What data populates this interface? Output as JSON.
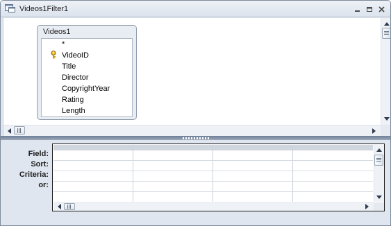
{
  "window": {
    "title": "Videos1Filter1",
    "controls": [
      "minimize",
      "restore",
      "close"
    ]
  },
  "table_box": {
    "title": "Videos1",
    "fields": [
      {
        "name": "*",
        "primary_key": false
      },
      {
        "name": "VideoID",
        "primary_key": true
      },
      {
        "name": "Title",
        "primary_key": false
      },
      {
        "name": "Director",
        "primary_key": false
      },
      {
        "name": "CopyrightYear",
        "primary_key": false
      },
      {
        "name": "Rating",
        "primary_key": false
      },
      {
        "name": "Length",
        "primary_key": false
      }
    ]
  },
  "design_grid": {
    "row_labels": [
      "Field:",
      "Sort:",
      "Criteria:",
      "or:"
    ],
    "column_count": 4,
    "cells": [
      [
        "",
        "",
        "",
        ""
      ],
      [
        "",
        "",
        "",
        ""
      ],
      [
        "",
        "",
        "",
        ""
      ],
      [
        "",
        "",
        "",
        ""
      ]
    ]
  },
  "colors": {
    "title_bar": "#dbe3ed",
    "splitter": "#6d7f99",
    "lower_pane": "#dfe6ef",
    "key_icon": "#d4a017"
  }
}
